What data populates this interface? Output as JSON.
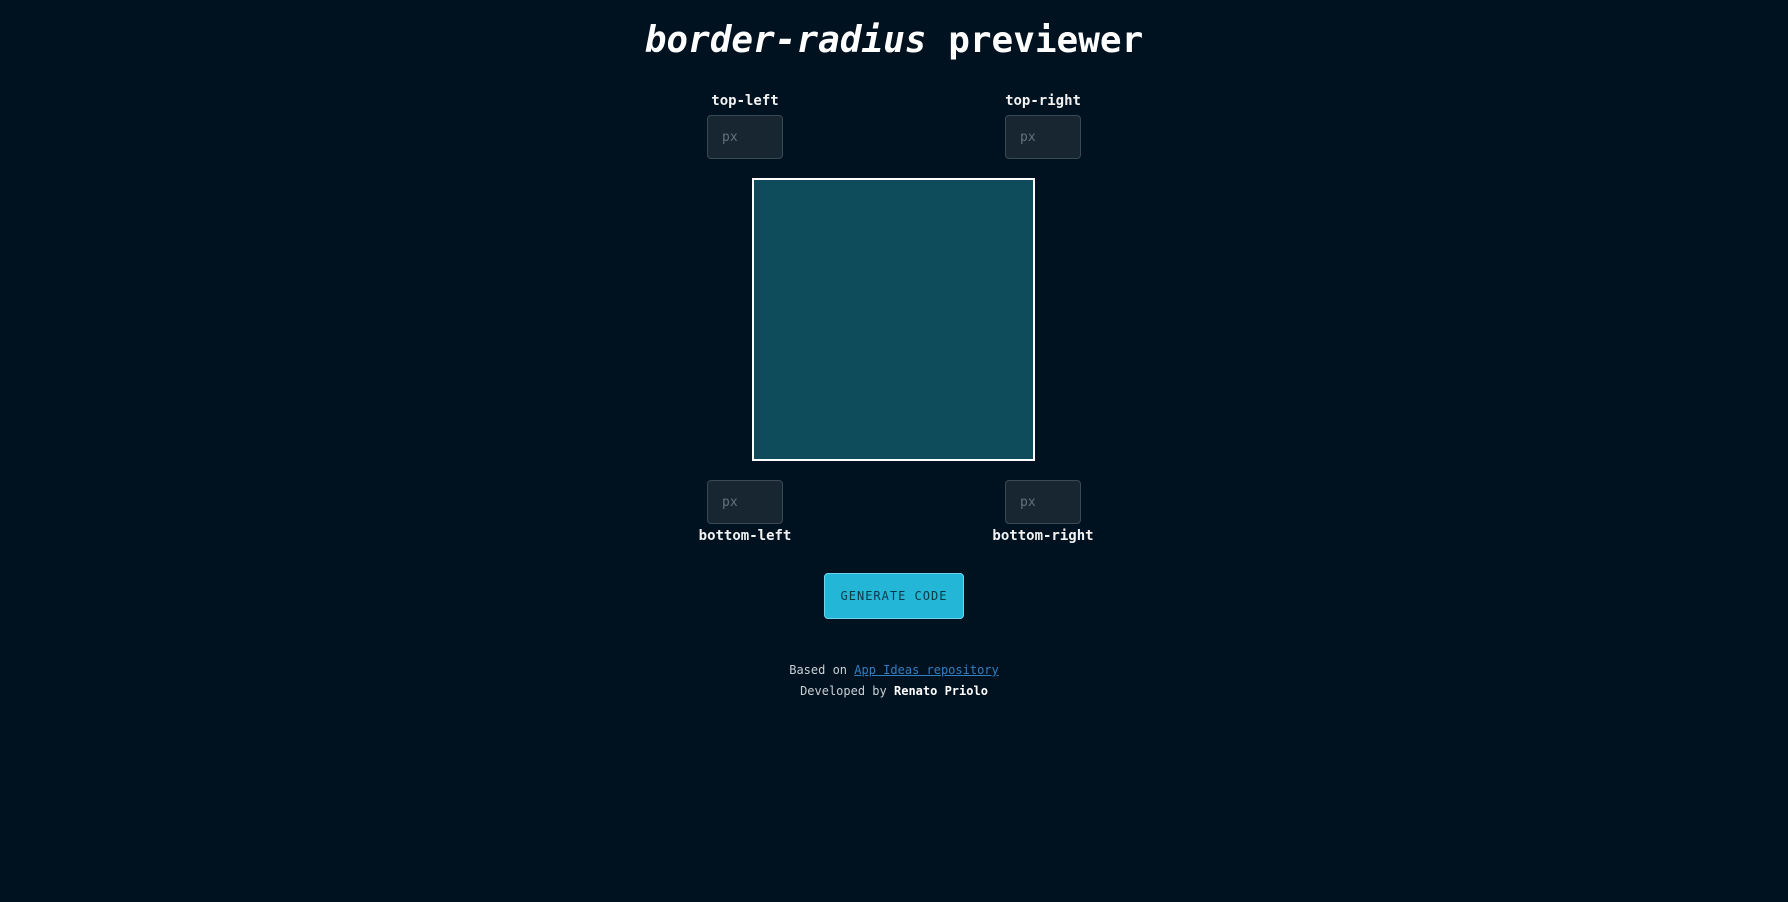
{
  "title": {
    "emphasis": "border-radius",
    "rest": "previewer"
  },
  "corners": {
    "top_left": {
      "label": "top-left",
      "placeholder": "px",
      "value": ""
    },
    "top_right": {
      "label": "top-right",
      "placeholder": "px",
      "value": ""
    },
    "bottom_left": {
      "label": "bottom-left",
      "placeholder": "px",
      "value": ""
    },
    "bottom_right": {
      "label": "bottom-right",
      "placeholder": "px",
      "value": ""
    }
  },
  "preview": {
    "fill_color": "#0e4b5b",
    "border_color": "#ffffff"
  },
  "generate_button": {
    "label": "GENERATE CODE",
    "color": "#23b6d6"
  },
  "footer": {
    "based_on_prefix": "Based on",
    "based_on_link": "App Ideas repository",
    "developed_by_prefix": "Developed by",
    "author": "Renato Priolo"
  },
  "colors": {
    "background": "#001220",
    "link": "#2f7fc1"
  }
}
